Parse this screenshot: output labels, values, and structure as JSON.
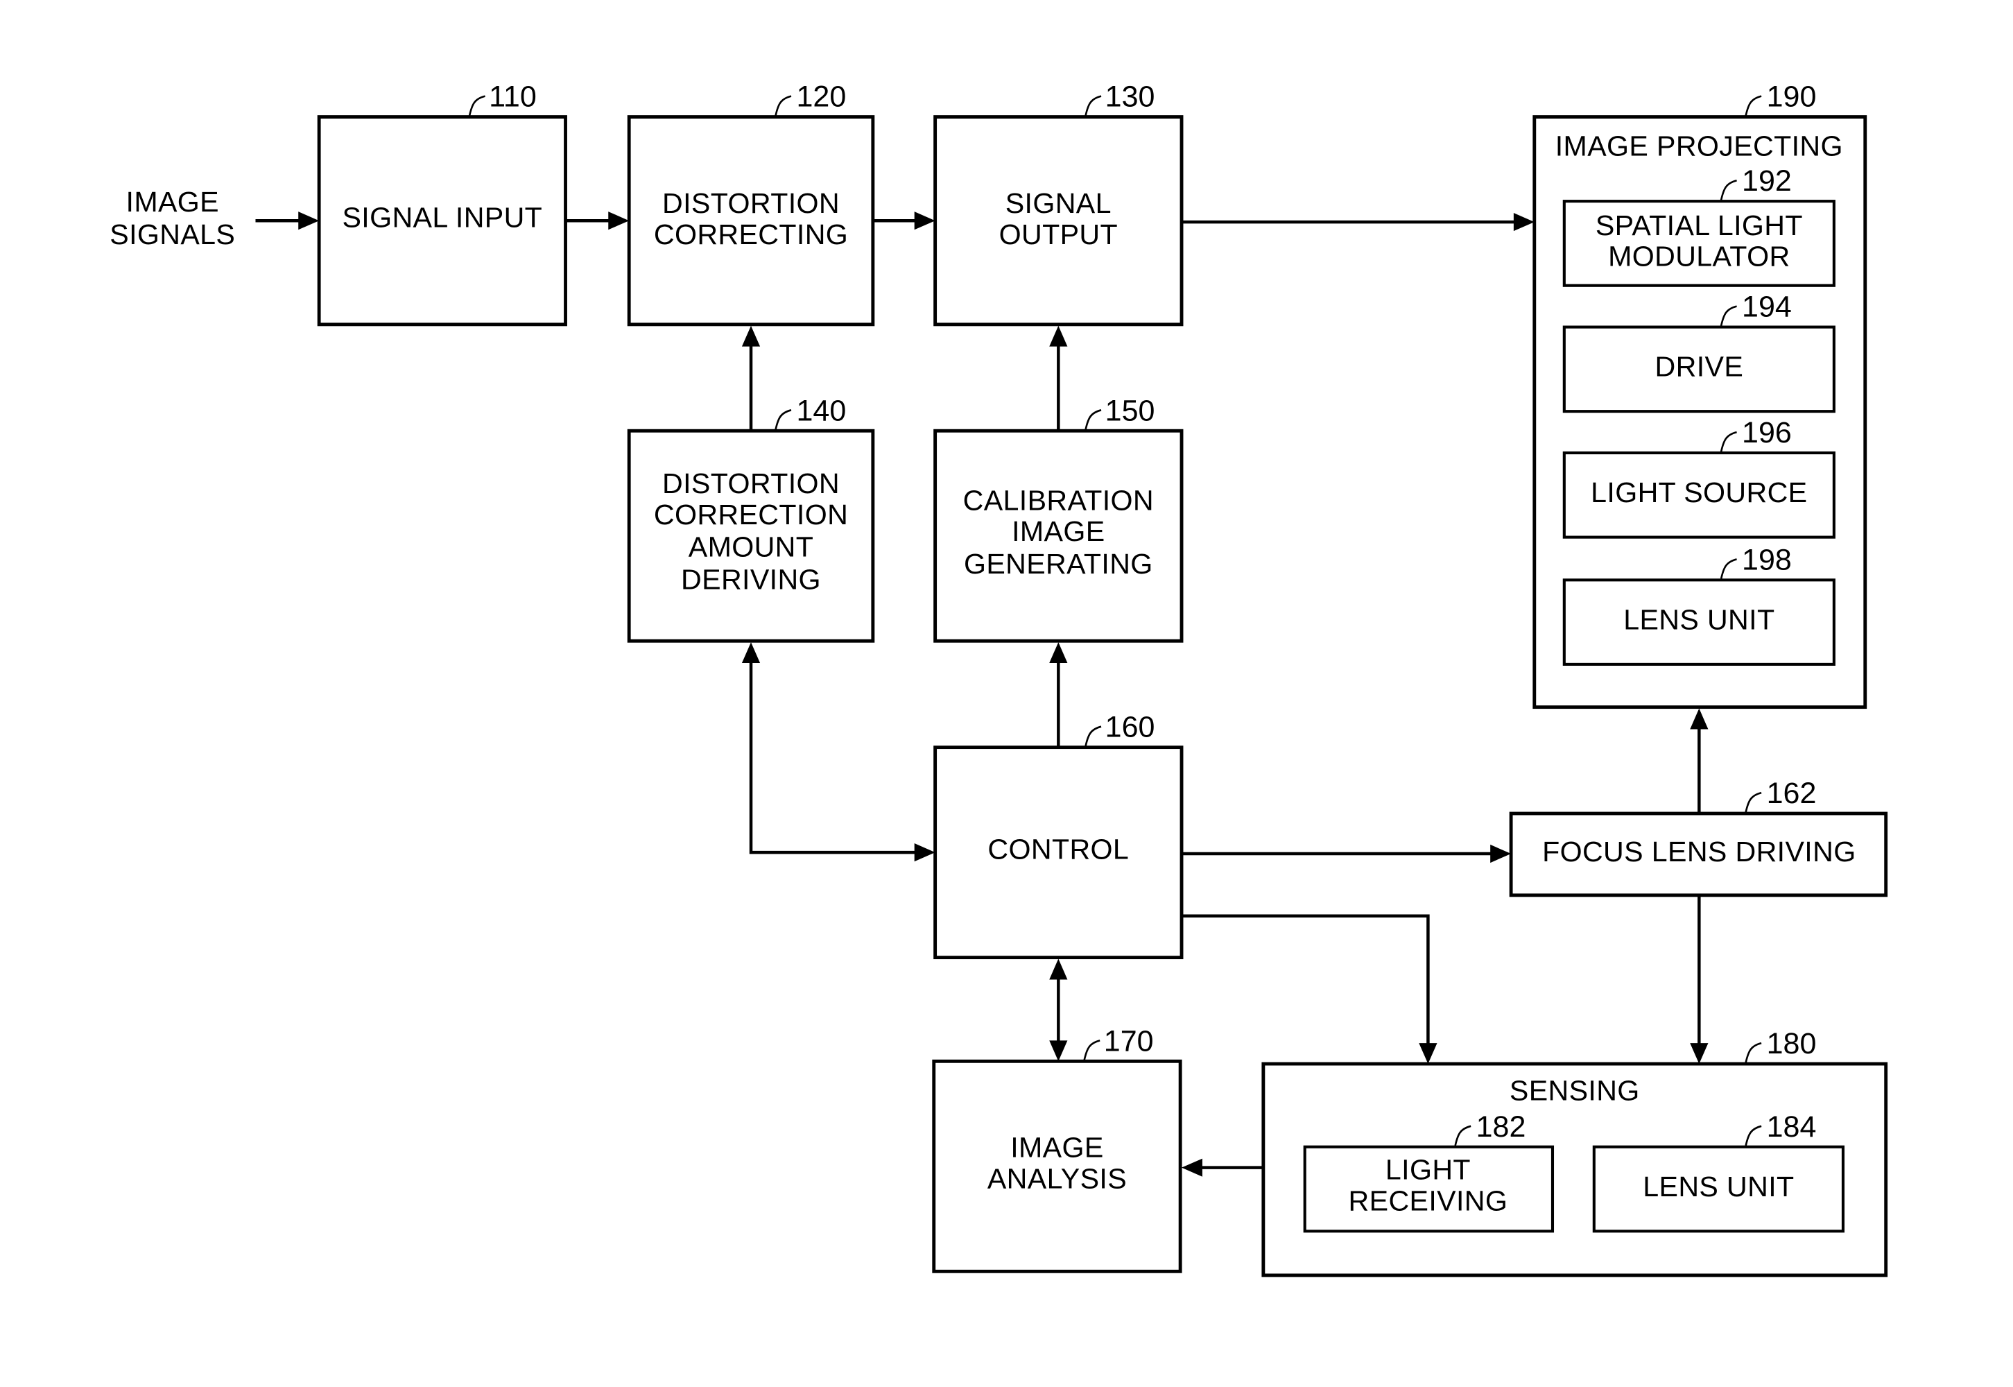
{
  "diagram": {
    "input_label": [
      "IMAGE",
      "SIGNALS"
    ],
    "blocks": {
      "b110": {
        "ref": "110",
        "lines": [
          "SIGNAL INPUT"
        ]
      },
      "b120": {
        "ref": "120",
        "lines": [
          "DISTORTION",
          "CORRECTING"
        ]
      },
      "b130": {
        "ref": "130",
        "lines": [
          "SIGNAL",
          "OUTPUT"
        ]
      },
      "b140": {
        "ref": "140",
        "lines": [
          "DISTORTION",
          "CORRECTION",
          "AMOUNT",
          "DERIVING"
        ]
      },
      "b150": {
        "ref": "150",
        "lines": [
          "CALIBRATION",
          "IMAGE",
          "GENERATING"
        ]
      },
      "b160": {
        "ref": "160",
        "lines": [
          "CONTROL"
        ]
      },
      "b162": {
        "ref": "162",
        "lines": [
          "FOCUS LENS DRIVING"
        ]
      },
      "b170": {
        "ref": "170",
        "lines": [
          "IMAGE",
          "ANALYSIS"
        ]
      },
      "b180": {
        "ref": "180",
        "lines": [
          "SENSING"
        ]
      },
      "b182": {
        "ref": "182",
        "lines": [
          "LIGHT",
          "RECEIVING"
        ]
      },
      "b184": {
        "ref": "184",
        "lines": [
          "LENS UNIT"
        ]
      },
      "b190": {
        "ref": "190",
        "lines": [
          "IMAGE PROJECTING"
        ]
      },
      "b192": {
        "ref": "192",
        "lines": [
          "SPATIAL LIGHT",
          "MODULATOR"
        ]
      },
      "b194": {
        "ref": "194",
        "lines": [
          "DRIVE"
        ]
      },
      "b196": {
        "ref": "196",
        "lines": [
          "LIGHT SOURCE"
        ]
      },
      "b198": {
        "ref": "198",
        "lines": [
          "LENS UNIT"
        ]
      }
    },
    "connections": [
      {
        "from": "IMAGE SIGNALS",
        "to": "110",
        "type": "arrow"
      },
      {
        "from": "110",
        "to": "120",
        "type": "arrow"
      },
      {
        "from": "120",
        "to": "130",
        "type": "arrow"
      },
      {
        "from": "130",
        "to": "190",
        "type": "arrow"
      },
      {
        "from": "140",
        "to": "120",
        "type": "arrow"
      },
      {
        "from": "150",
        "to": "130",
        "type": "arrow"
      },
      {
        "from": "160",
        "to": "150",
        "type": "arrow"
      },
      {
        "from": "160",
        "to": "140",
        "type": "bidirectional"
      },
      {
        "from": "160",
        "to": "162",
        "type": "arrow"
      },
      {
        "from": "160",
        "to": "180",
        "type": "arrow"
      },
      {
        "from": "162",
        "to": "190",
        "type": "arrow"
      },
      {
        "from": "162",
        "to": "180",
        "type": "arrow"
      },
      {
        "from": "160",
        "to": "170",
        "type": "bidirectional"
      },
      {
        "from": "180",
        "to": "170",
        "type": "arrow"
      }
    ]
  }
}
